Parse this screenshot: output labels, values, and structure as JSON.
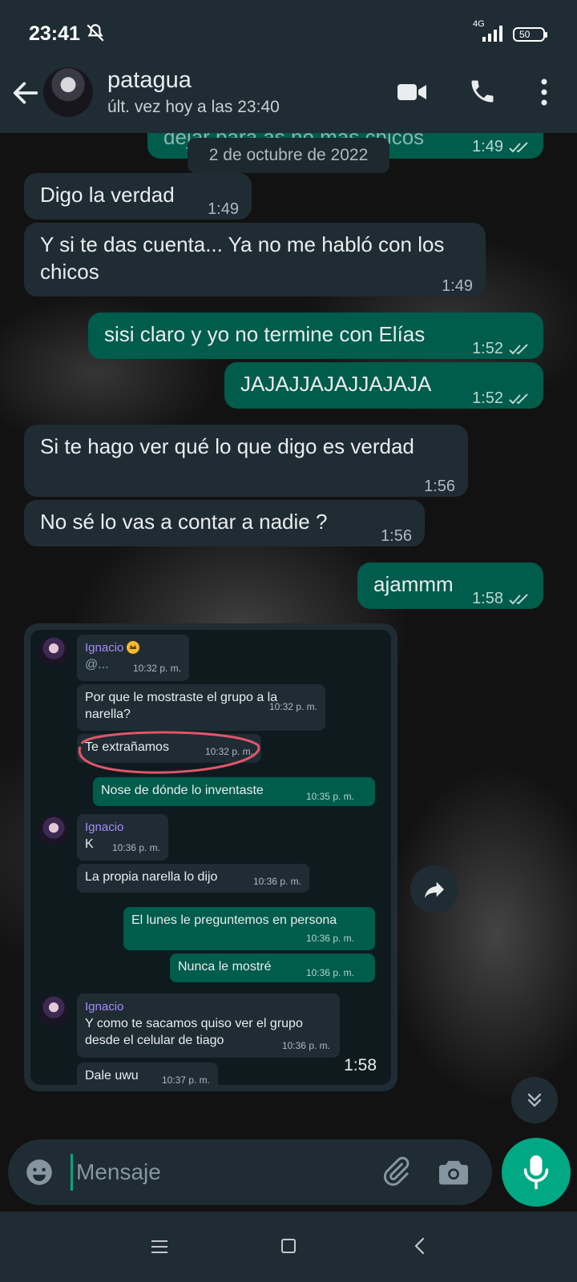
{
  "status_bar": {
    "time": "23:41",
    "network": "4G",
    "battery": "50"
  },
  "header": {
    "contact_name": "patagua",
    "last_seen": "últ. vez hoy a las 23:40"
  },
  "chat": {
    "top_partial_message": {
      "text": "dejar para as no mas chicos",
      "time": "1:49"
    },
    "date_chip": "2 de octubre de 2022",
    "messages": [
      {
        "direction": "in",
        "text": "Digo la verdad",
        "time": "1:49"
      },
      {
        "direction": "in",
        "text": "Y si te das cuenta... Ya no me habló con los chicos",
        "time": "1:49"
      },
      {
        "direction": "out",
        "text": "sisi claro y yo no termine con Elías",
        "time": "1:52"
      },
      {
        "direction": "out",
        "text": "JAJAJJAJAJJAJAJA",
        "time": "1:52"
      },
      {
        "direction": "in",
        "text": "Si te hago ver qué lo que digo es verdad",
        "time": "1:56"
      },
      {
        "direction": "in",
        "text": "No sé lo vas a contar a nadie ?",
        "time": "1:56"
      },
      {
        "direction": "out",
        "text": "ajammm",
        "time": "1:58"
      }
    ],
    "image_message_time": "1:58"
  },
  "screenshot": {
    "sender": "Ignacio",
    "messages": [
      {
        "text": "@...",
        "time": "10:32 p. m."
      },
      {
        "text": "Por que le mostraste el grupo a la narella?",
        "time": "10:32 p. m."
      },
      {
        "text": "Te extrañamos",
        "time": "10:32 p. m."
      },
      {
        "text": "Nose de dónde lo inventaste",
        "time": "10:35 p. m."
      },
      {
        "text": "K",
        "time": "10:36 p. m."
      },
      {
        "text": "La propia narella lo dijo",
        "time": "10:36 p. m."
      },
      {
        "text": "El lunes le preguntemos en persona",
        "time": "10:36 p. m."
      },
      {
        "text": "Nunca le mostré",
        "time": "10:36 p. m."
      },
      {
        "text": "Y como te sacamos quiso ver el grupo desde el celular de tiago",
        "time": "10:36 p. m."
      },
      {
        "text": "Dale uwu",
        "time": "10:37 p. m."
      }
    ]
  },
  "composer": {
    "placeholder": "Mensaje"
  },
  "colors": {
    "outgoing": "#005c4b",
    "incoming": "#202c33",
    "accent": "#00a884",
    "bar": "#1f2c34"
  },
  "icons": [
    "back-arrow-icon",
    "video-call-icon",
    "phone-icon",
    "more-icon",
    "emoji-icon",
    "attach-icon",
    "camera-icon",
    "mic-icon",
    "forward-icon",
    "chevron-down-icon"
  ]
}
